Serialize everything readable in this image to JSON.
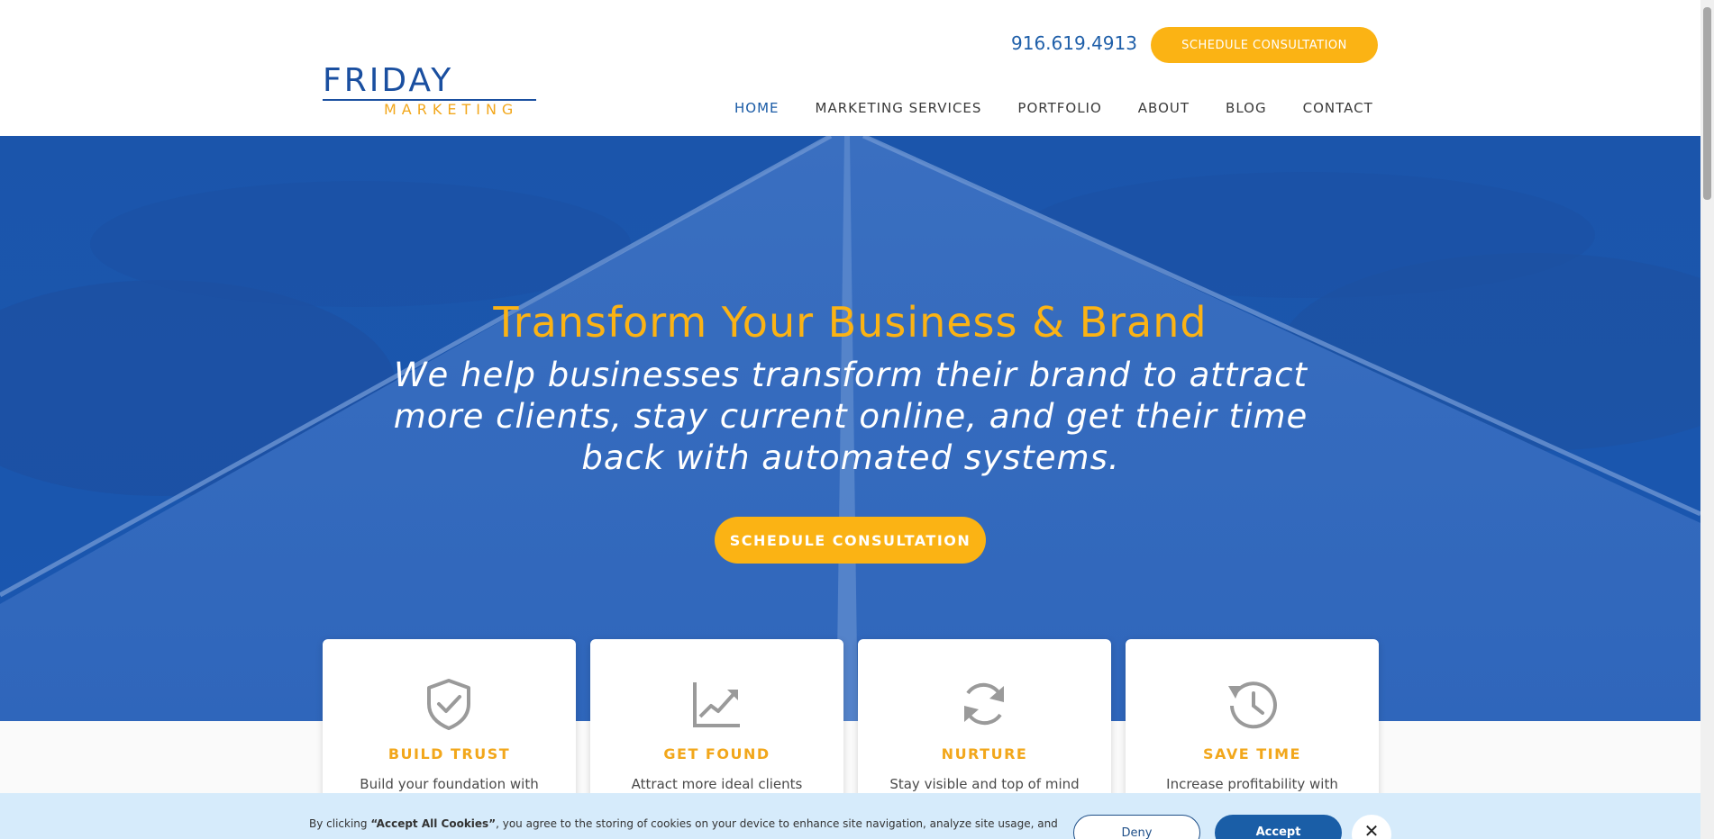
{
  "header": {
    "logo_top": "FRIDAY",
    "logo_bottom": "MARKETING",
    "phone": "916.619.4913",
    "cta_label": "SCHEDULE CONSULTATION"
  },
  "nav": {
    "items": [
      {
        "label": "HOME",
        "active": true
      },
      {
        "label": "MARKETING SERVICES",
        "active": false
      },
      {
        "label": "PORTFOLIO",
        "active": false
      },
      {
        "label": "ABOUT",
        "active": false
      },
      {
        "label": "BLOG",
        "active": false
      },
      {
        "label": "CONTACT",
        "active": false
      }
    ]
  },
  "hero": {
    "title": "Transform Your Business & Brand",
    "subtitle": "We help businesses transform their brand to attract more clients, stay current online, and get their time back with automated systems.",
    "cta_label": "SCHEDULE CONSULTATION"
  },
  "cards": [
    {
      "icon": "shield-check-icon",
      "title": "BUILD TRUST",
      "text": "Build your foundation with"
    },
    {
      "icon": "trending-up-icon",
      "title": "GET FOUND",
      "text": "Attract more ideal clients"
    },
    {
      "icon": "refresh-icon",
      "title": "NURTURE",
      "text": "Stay visible and top of mind"
    },
    {
      "icon": "history-icon",
      "title": "SAVE TIME",
      "text": "Increase profitability with"
    }
  ],
  "cookie": {
    "text_prefix": "By clicking ",
    "text_bold": "“Accept All Cookies”",
    "text_suffix": ", you agree to the storing of cookies on your device to enhance site navigation, analyze site usage, and",
    "deny_label": "Deny",
    "accept_label": "Accept",
    "close_label": "✕"
  },
  "colors": {
    "brand_blue": "#1a57b0",
    "accent_yellow": "#fbb314",
    "cookie_bg": "#d6ebfb"
  }
}
